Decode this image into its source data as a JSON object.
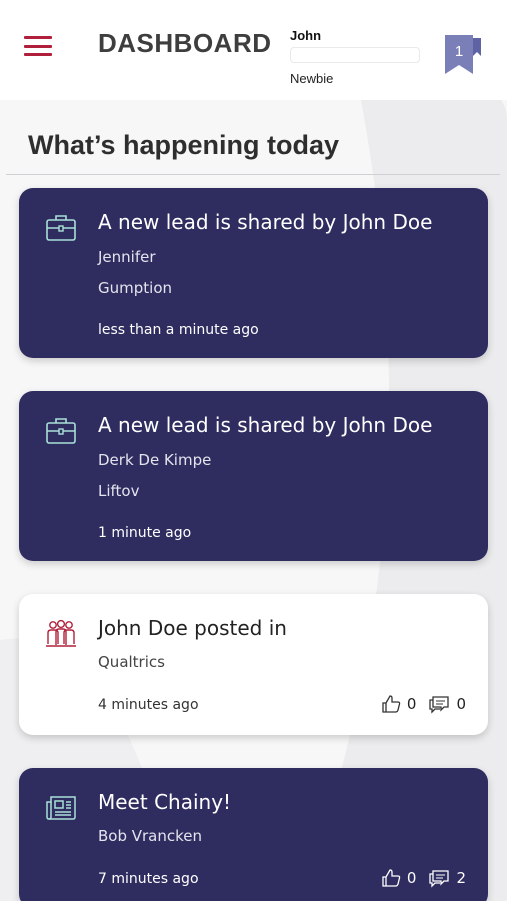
{
  "header": {
    "title": "DASHBOARD",
    "user_name": "John",
    "user_rank": "Newbie",
    "progress_fraction": 0.0,
    "bookmark_count": "1"
  },
  "section": {
    "title": "What’s happening today"
  },
  "feed": [
    {
      "type": "lead",
      "icon": "briefcase-icon",
      "title": "A new lead is shared by John Doe",
      "line1": "Jennifer",
      "line2": "Gumption",
      "time": "less than a minute ago"
    },
    {
      "type": "lead",
      "icon": "briefcase-icon",
      "title": "A new lead is shared by John Doe",
      "line1": "Derk De Kimpe",
      "line2": "Liftov",
      "time": "1 minute ago"
    },
    {
      "type": "post",
      "icon": "group-icon",
      "title": "John Doe posted in",
      "line1": "Qualtrics",
      "time": "4 minutes ago",
      "likes": "0",
      "comments": "0"
    },
    {
      "type": "news",
      "icon": "newspaper-icon",
      "title": "Meet Chainy!",
      "line1": "Bob Vrancken",
      "time": "7 minutes ago",
      "likes": "0",
      "comments": "2"
    }
  ],
  "colors": {
    "card_dark": "#2f2c60",
    "accent_red": "#b0203a",
    "bookmark": "#7b7fb8",
    "icon_teal": "#a8e0d8"
  }
}
